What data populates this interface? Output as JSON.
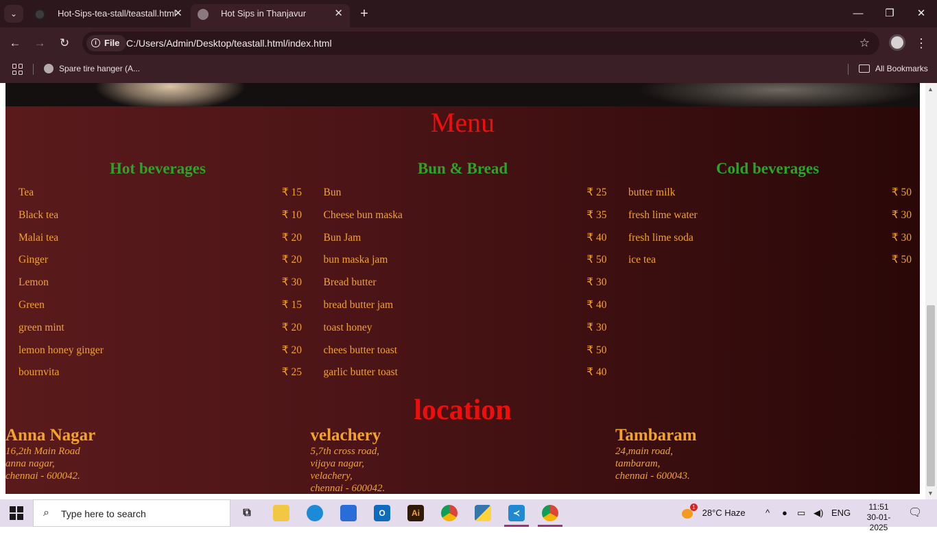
{
  "browser": {
    "tabs": [
      {
        "label": "Hot-Sips-tea-stall/teastall.html",
        "active": false
      },
      {
        "label": "Hot Sips in Thanjavur",
        "active": true
      }
    ],
    "address": {
      "scheme_label": "File",
      "url": "C:/Users/Admin/Desktop/teastall.html/index.html"
    },
    "bookmarks": [
      {
        "label": "Spare tire hanger (A..."
      }
    ],
    "all_bookmarks_label": "All Bookmarks"
  },
  "page": {
    "menu_title": "Menu",
    "categories": [
      {
        "title": "Hot beverages",
        "items": [
          {
            "name": "Tea",
            "price": "₹ 15"
          },
          {
            "name": "Black tea",
            "price": "₹ 10"
          },
          {
            "name": "Malai tea",
            "price": "₹ 20"
          },
          {
            "name": "Ginger",
            "price": "₹ 20"
          },
          {
            "name": "Lemon",
            "price": "₹ 30"
          },
          {
            "name": "Green",
            "price": "₹ 15"
          },
          {
            "name": "green mint",
            "price": "₹ 20"
          },
          {
            "name": "lemon honey ginger",
            "price": "₹ 20"
          },
          {
            "name": "bournvita",
            "price": "₹ 25"
          }
        ]
      },
      {
        "title": "Bun & Bread",
        "items": [
          {
            "name": "Bun",
            "price": "₹ 25"
          },
          {
            "name": "Cheese bun maska",
            "price": "₹ 35"
          },
          {
            "name": "Bun Jam",
            "price": "₹ 40"
          },
          {
            "name": "bun maska jam",
            "price": "₹ 50"
          },
          {
            "name": "Bread butter",
            "price": "₹ 30"
          },
          {
            "name": "bread butter jam",
            "price": "₹ 40"
          },
          {
            "name": "toast honey",
            "price": "₹ 30"
          },
          {
            "name": "chees butter toast",
            "price": "₹ 50"
          },
          {
            "name": "garlic butter toast",
            "price": "₹ 40"
          }
        ]
      },
      {
        "title": "Cold beverages",
        "items": [
          {
            "name": "butter milk",
            "price": "₹ 50"
          },
          {
            "name": "fresh lime water",
            "price": "₹ 30"
          },
          {
            "name": "fresh lime soda",
            "price": "₹ 30"
          },
          {
            "name": "ice tea",
            "price": "₹ 50"
          }
        ]
      }
    ],
    "location_title": "location",
    "locations": [
      {
        "name": "Anna Nagar",
        "lines": [
          "16,2th Main Road",
          "anna nagar,",
          "chennai - 600042."
        ]
      },
      {
        "name": "velachery",
        "lines": [
          "5,7th cross road,",
          "vijaya nagar,",
          "velachery,",
          "chennai - 600042."
        ]
      },
      {
        "name": "Tambaram",
        "lines": [
          "24,main road,",
          "tambaram,",
          "chennai - 600043."
        ]
      }
    ]
  },
  "taskbar": {
    "search_placeholder": "Type here to search",
    "weather": "28°C  Haze",
    "weather_badge": "1",
    "language": "ENG",
    "time": "11:51",
    "date": "30-01-2025",
    "apps": [
      "task-view",
      "file-explorer",
      "edge",
      "store",
      "outlook",
      "illustrator",
      "chrome",
      "python",
      "vscode",
      "chrome-profile"
    ]
  },
  "colors": {
    "menu_title": "#f20d0d",
    "category_title": "#2aa52a",
    "item_text": "#f3a428"
  }
}
